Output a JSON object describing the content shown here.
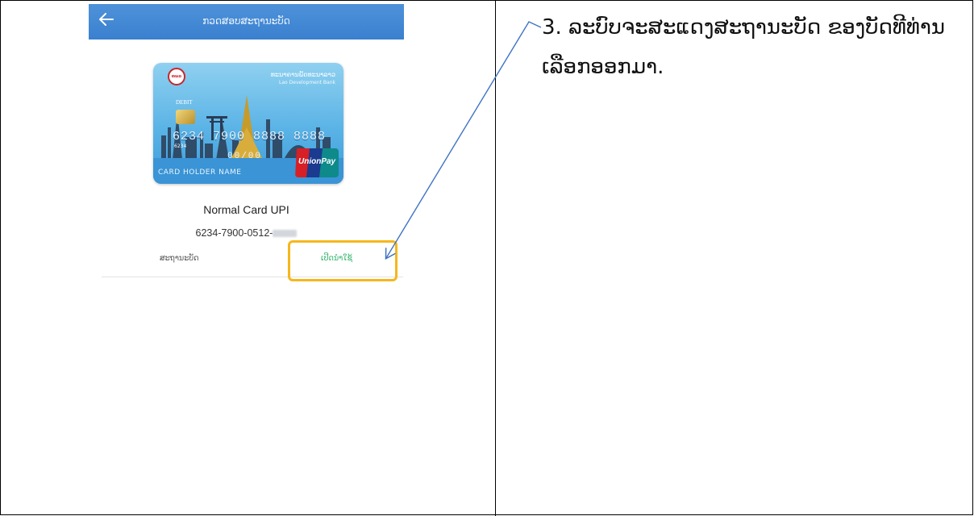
{
  "phone": {
    "header_title": "ກວດສອບສະຖານະບັດ",
    "card": {
      "bank_name": "ທະນາຄານພັດທະນາລາວ",
      "bank_name_en": "Lao Development Bank",
      "logo_text": "ທພລ",
      "debit_label": "DEBIT",
      "number": "6234 7900 8888 8888",
      "prefix": "6234",
      "valid": "00/00",
      "holder": "CARD HOLDER NAME",
      "network": "UnionPay"
    },
    "card_name": "Normal Card UPI",
    "account_number": "6234-7900-0512-",
    "status_label": "ສະຖານະບັດ",
    "status_value": "ເປີດນຳໃຊ້"
  },
  "instruction": {
    "step": "3.",
    "text": "ລະບົບຈະສະແດງສະຖານະບັດ ຂອງບັດທີທ່ານເລືອກອອກມາ."
  },
  "colors": {
    "header_blue": "#3f86d3",
    "highlight": "#f6b71c",
    "arrow": "#3f74c4",
    "status_green": "#2fb36a"
  },
  "icons": [
    "back-arrow-icon",
    "bank-logo-icon",
    "unionpay-logo-icon",
    "chip-icon"
  ]
}
